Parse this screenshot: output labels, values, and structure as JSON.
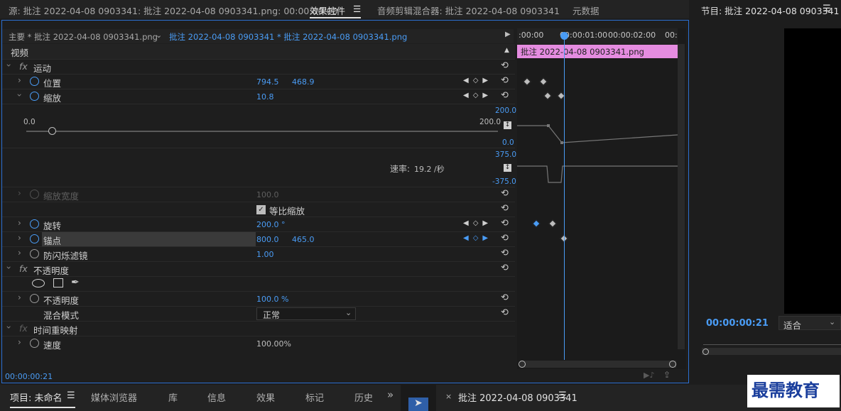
{
  "top_tabs": {
    "source": "源: 批注 2022-04-08 0903341: 批注 2022-04-08 0903341.png: 00:00:00:00",
    "effect_controls": "效果控件",
    "menu_glyph": "☰",
    "audio_mixer": "音频剪辑混合器: 批注 2022-04-08 0903341",
    "metadata": "元数据",
    "program": "节目: 批注 2022-04-08 0903341",
    "program_menu": "☰"
  },
  "source_bar": {
    "master": "主要 * 批注 2022-04-08 0903341.png",
    "clip": "批注 2022-04-08 0903341 * 批注 2022-04-08 0903341.png"
  },
  "ruler": {
    "ticks": [
      ":00:00",
      "00:00:01:00",
      "00:00:02:00",
      "00:"
    ],
    "clip_name": "批注 2022-04-08 0903341.png"
  },
  "sections": {
    "video": "视频",
    "motion": "运动",
    "opacity_section": "不透明度",
    "time_remap": "时间重映射"
  },
  "fx_glyph": "fx",
  "motion": {
    "position": {
      "label": "位置",
      "x": "794.5",
      "y": "468.9"
    },
    "scale": {
      "label": "缩放",
      "value": "10.8"
    },
    "scale_graph": {
      "top": "200.0",
      "bottom": "0.0",
      "slider_min": "0.0",
      "slider_max": "200.0",
      "slider_fraction": 0.054,
      "vel_top": "375.0",
      "vel_bottom": "-375.0",
      "rate_label": "速率:",
      "rate_value": "19.2 /秒"
    },
    "scale_width": {
      "label": "缩放宽度",
      "value": "100.0"
    },
    "uniform_scale": {
      "label": "等比缩放",
      "checked": true
    },
    "rotation": {
      "label": "旋转",
      "value": "200.0 °"
    },
    "anchor": {
      "label": "锚点",
      "x": "800.0",
      "y": "465.0"
    },
    "flicker": {
      "label": "防闪烁滤镜",
      "value": "1.00"
    }
  },
  "opacity": {
    "label": "不透明度",
    "value": "100.0 %",
    "blend_label": "混合模式",
    "blend_value": "正常"
  },
  "time_remap": {
    "speed_label": "速度",
    "speed_value": "100.00%"
  },
  "footer_timecode": "00:00:00:21",
  "program": {
    "timecode": "00:00:00:21",
    "fit": "适合"
  },
  "bottom_tabs": {
    "project": "项目: 未命名",
    "project_menu": "☰",
    "media_browser": "媒体浏览器",
    "library": "库",
    "info": "信息",
    "effects": "效果",
    "markers": "标记",
    "history": "历史",
    "more": "»",
    "timeline_tab": "批注 2022-04-08 0903341",
    "timeline_menu": "☰",
    "close": "×"
  },
  "watermark": "最需教育",
  "colors": {
    "accent": "#4a9cf5",
    "clip": "#e58ce0",
    "panel_border": "#2c6fd1"
  }
}
